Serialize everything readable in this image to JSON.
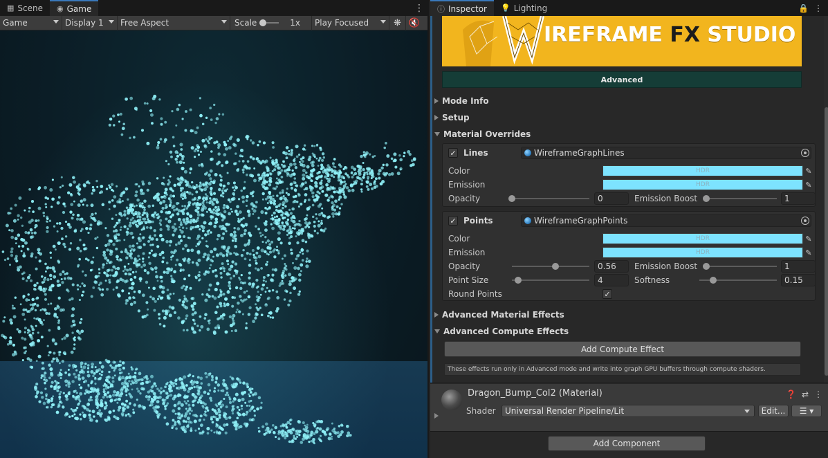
{
  "game_panel": {
    "tabs": [
      {
        "label": "Scene",
        "icon": "grid-icon",
        "active": false
      },
      {
        "label": "Game",
        "icon": "gamepad-icon",
        "active": true
      }
    ],
    "toolbar": {
      "display_mode": "Game",
      "display": "Display 1",
      "aspect": "Free Aspect",
      "scale_label": "Scale",
      "scale_value": "1x",
      "play_mode": "Play Focused"
    },
    "scene_colors": {
      "points": "#8ff0f7",
      "glow": "#46c8dc",
      "floor": "#173a52"
    }
  },
  "inspector": {
    "tabs": [
      {
        "label": "Inspector",
        "icon": "info-icon",
        "active": true
      },
      {
        "label": "Lighting",
        "icon": "bulb-icon",
        "active": false
      }
    ],
    "banner": {
      "title_part1": "IREFRAME ",
      "title_fx": "FX",
      "title_part2": " STUDIO",
      "color": "#f2b51e"
    },
    "mode_bar": "Advanced",
    "foldouts": {
      "mode_info": "Mode Info",
      "setup": "Setup",
      "material_overrides": "Material Overrides",
      "advanced_material_effects": "Advanced Material Effects",
      "advanced_compute_effects": "Advanced Compute Effects"
    },
    "lines": {
      "label": "Lines",
      "enabled": true,
      "material": "WireframeGraphLines",
      "color_label": "Color",
      "emission_label": "Emission",
      "hdr": "HDR",
      "opacity_label": "Opacity",
      "opacity": "0",
      "opacity_fraction": 0,
      "emission_boost_label": "Emission Boost",
      "emission_boost": "1",
      "emission_boost_fraction": 0,
      "swatch_color": "#7de3ff"
    },
    "points": {
      "label": "Points",
      "enabled": true,
      "material": "WireframeGraphPoints",
      "color_label": "Color",
      "emission_label": "Emission",
      "hdr": "HDR",
      "opacity_label": "Opacity",
      "opacity": "0.56",
      "opacity_fraction": 0.56,
      "emission_boost_label": "Emission Boost",
      "emission_boost": "1",
      "emission_boost_fraction": 0,
      "point_size_label": "Point Size",
      "point_size": "4",
      "point_size_fraction": 0.08,
      "softness_label": "Softness",
      "softness": "0.15",
      "softness_fraction": 0.18,
      "round_points_label": "Round Points",
      "round_points": true,
      "swatch_color": "#7de3ff"
    },
    "add_compute_effect": "Add Compute Effect",
    "compute_help": "These effects run only in Advanced mode and write into graph GPU buffers through compute shaders.",
    "material": {
      "name": "Dragon_Bump_Col2 (Material)",
      "shader_label": "Shader",
      "shader": "Universal Render Pipeline/Lit",
      "edit_label": "Edit..."
    },
    "add_component": "Add Component"
  }
}
